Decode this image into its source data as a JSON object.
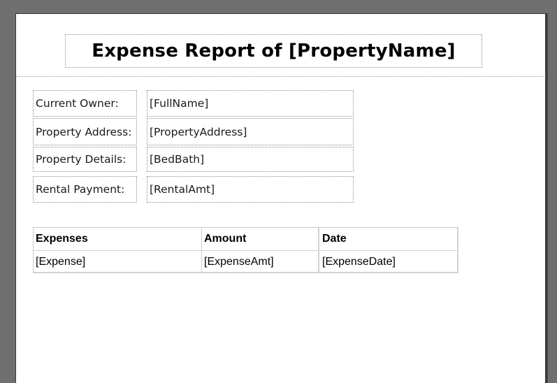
{
  "report": {
    "title": "Expense Report of [PropertyName]"
  },
  "details": {
    "owner_label": "Current Owner:",
    "owner_value": "[FullName]",
    "address_label": "Property Address:",
    "address_value": "[PropertyAddress]",
    "details_label": "Property Details:",
    "details_value": "[BedBath]",
    "payment_label": "Rental Payment:",
    "payment_value": "[RentalAmt]"
  },
  "expenses_table": {
    "headers": [
      "Expenses",
      "Amount",
      "Date"
    ],
    "row": [
      "[Expense]",
      "[ExpenseAmt]",
      "[ExpenseDate]"
    ]
  }
}
